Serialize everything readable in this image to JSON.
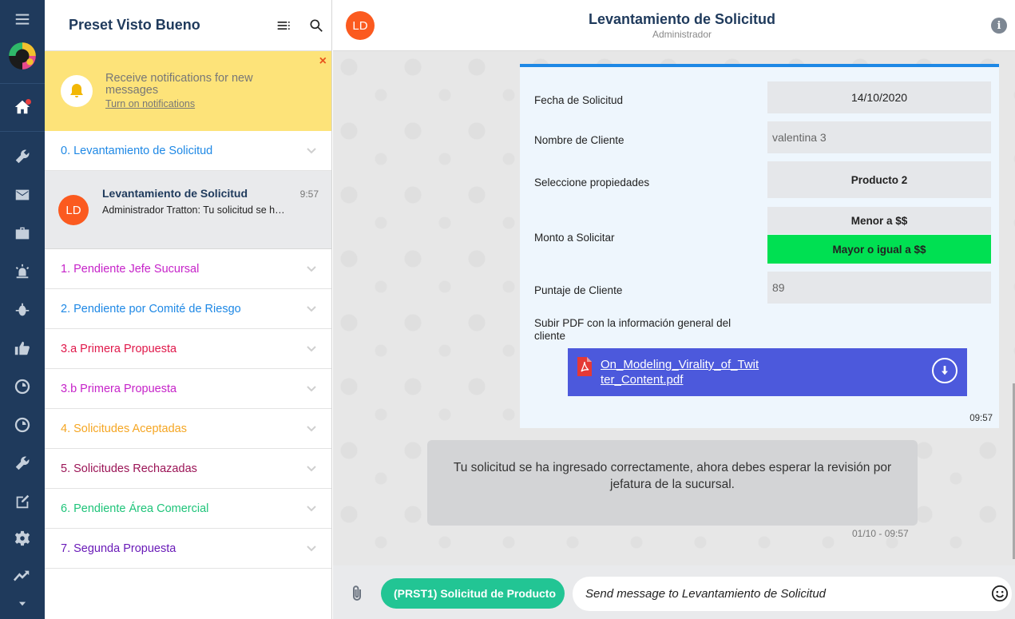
{
  "colors": {
    "rail_bg": "#1f3a5c",
    "accent_blue": "#1e88e5",
    "avatar_orange": "#fb5a1f",
    "notif_yellow": "#fde379",
    "green_selected": "#00e052",
    "preset_green": "#22c594",
    "pdf_blue": "#4c59dc"
  },
  "sidebar": {
    "title": "Preset Visto Bueno",
    "notification": {
      "message": "Receive notifications for new messages",
      "link": "Turn on notifications",
      "close": "×"
    },
    "groups": [
      {
        "label": "0. Levantamiento de Solicitud",
        "color": "#1e88e5"
      },
      {
        "label": "1. Pendiente Jefe Sucursal",
        "color": "#c623c9"
      },
      {
        "label": "2. Pendiente por Comité de Riesgo",
        "color": "#1e88e5"
      },
      {
        "label": "3.a Primera Propuesta",
        "color": "#e0174a"
      },
      {
        "label": "3.b Primera Propuesta",
        "color": "#c623c9"
      },
      {
        "label": "4. Solicitudes Aceptadas",
        "color": "#f5a623"
      },
      {
        "label": "5. Solicitudes Rechazadas",
        "color": "#9b1456"
      },
      {
        "label": "6. Pendiente Área Comercial",
        "color": "#1fc47a"
      },
      {
        "label": "7. Segunda Propuesta",
        "color": "#6a1bb8"
      }
    ],
    "chat": {
      "initials": "LD",
      "title": "Levantamiento de Solicitud",
      "time": "9:57",
      "preview": "Administrador Tratton: Tu solicitud se ha ingresado correctamente"
    }
  },
  "header": {
    "initials": "LD",
    "title": "Levantamiento de Solicitud",
    "subtitle": "Administrador",
    "info": "i"
  },
  "form": {
    "fields": [
      {
        "label": "Fecha de Solicitud",
        "value": "14/10/2020"
      },
      {
        "label": "Nombre de Cliente",
        "value": "valentina 3"
      },
      {
        "label": "Seleccione propiedades",
        "value": "Producto 2"
      },
      {
        "label": "Monto a Solicitar",
        "options": [
          "Menor a $$",
          "Mayor o igual a $$"
        ],
        "selected": "Mayor o igual a $$"
      },
      {
        "label": "Puntaje de Cliente",
        "value": "89"
      },
      {
        "label": "Subir PDF con la información general del cliente"
      }
    ],
    "pdf_name": "On_Modeling_Virality_of_Twitter_Content.pdf",
    "time": "09:57"
  },
  "message": {
    "text": "Tu solicitud se ha ingresado correctamente, ahora debes esperar la revisión por jefatura de la sucursal.",
    "time": "01/10 - 09:57"
  },
  "composer": {
    "preset_button": "(PRST1) Solicitud de Producto",
    "placeholder": "Send message to Levantamiento de Solicitud"
  }
}
